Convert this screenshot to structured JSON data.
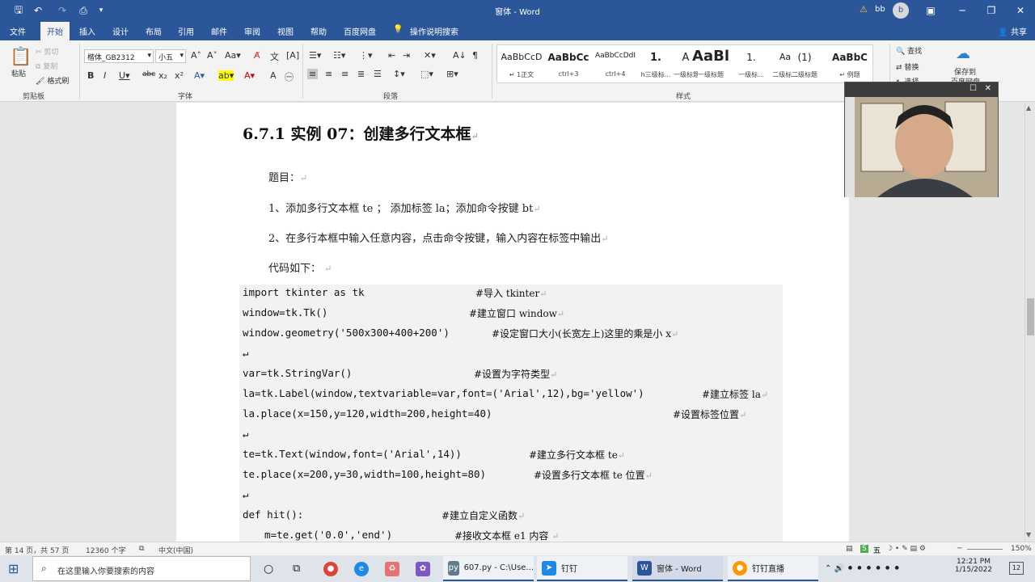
{
  "titlebar": {
    "title": "窗体 - Word",
    "user": "bb",
    "avatar": "b",
    "warn": "⚠"
  },
  "tabs": [
    "文件",
    "开始",
    "插入",
    "设计",
    "布局",
    "引用",
    "邮件",
    "审阅",
    "视图",
    "帮助",
    "百度网盘"
  ],
  "tell_me": "操作说明搜索",
  "share": "共享",
  "clipboard": {
    "paste": "粘贴",
    "cut": "剪切",
    "copy": "复制",
    "format_painter": "格式刷",
    "label": "剪贴板"
  },
  "font": {
    "name": "楷体_GB2312",
    "size": "小五",
    "label": "字体"
  },
  "paragraph": {
    "label": "段落"
  },
  "styles": {
    "label": "样式",
    "items": [
      {
        "preview": "AaBbCcD",
        "name": "↵ 1正文"
      },
      {
        "preview": "AaBbCc",
        "name": "ctrl+3"
      },
      {
        "preview": "AaBbCcDdI",
        "name": "ctrl+4"
      },
      {
        "preview": "1.",
        "name": "h三级标..."
      },
      {
        "preview": "A",
        "name": "一级标题"
      },
      {
        "preview": "AaBl",
        "name": "一级标题"
      },
      {
        "preview": "1.",
        "name": "一级标..."
      },
      {
        "preview": "Aa",
        "name": "二级标..."
      },
      {
        "preview": "(1)",
        "name": "二级标题"
      },
      {
        "preview": "AaBbC",
        "name": "↵ 例题"
      }
    ]
  },
  "editing": {
    "find": "查找",
    "replace": "替换",
    "select": "选择",
    "save_to": "保存到",
    "save_to2": "百度网盘"
  },
  "document": {
    "heading": "6.7.1 实例 07：创建多行文本框",
    "paragraphs": [
      "题目：",
      "1、添加多行文本框 te ； 添加标签 la；添加命令按键 bt",
      "2、在多行本框中输入任意内容，点击命令按键，输入内容在标签中输出",
      "代码如下："
    ],
    "code": [
      {
        "code": "import tkinter as tk",
        "comment": "#导入 tkinter"
      },
      {
        "code": "window=tk.Tk()",
        "comment": "#建立窗口 window"
      },
      {
        "code": "window.geometry('500x300+400+200')",
        "comment": "#设定窗口大小(长宽左上)这里的乘是小 x"
      },
      {
        "code": "",
        "comment": ""
      },
      {
        "code": "var=tk.StringVar()",
        "comment": "#设置为字符类型"
      },
      {
        "code": "la=tk.Label(window,textvariable=var,font=('Arial',12),bg='yellow')",
        "comment": "#建立标签 la"
      },
      {
        "code": "la.place(x=150,y=120,width=200,height=40)",
        "comment": "#设置标签位置"
      },
      {
        "code": "",
        "comment": ""
      },
      {
        "code": "te=tk.Text(window,font=('Arial',14))",
        "comment": "#建立多行文本框 te"
      },
      {
        "code": "te.place(x=200,y=30,width=100,height=80)",
        "comment": "#设置多行文本框 te 位置"
      },
      {
        "code": "",
        "comment": ""
      },
      {
        "code": "def hit():",
        "comment": "#建立自定义函数"
      },
      {
        "code": "  m=te.get('0.0','end')",
        "comment": "#接收文本框 e1 内容"
      }
    ]
  },
  "status": {
    "page": "第 14 页，共 57 页",
    "words": "12360 个字",
    "lang": "中文(中国)",
    "zoom": "150%"
  },
  "ime": {
    "label": "五"
  },
  "taskbar": {
    "search_placeholder": "在这里输入你要搜索的内容",
    "apps": [
      {
        "label": "607.py - C:\\Use..."
      },
      {
        "label": "钉钉"
      },
      {
        "label": "窗体 - Word"
      },
      {
        "label": "钉钉直播"
      }
    ],
    "time": "12:21 PM",
    "date": "1/15/2022",
    "notif": "12"
  },
  "colors": {
    "accent": "#2b579a",
    "page": "#ffffff",
    "code_bg": "#f2f2f2"
  }
}
